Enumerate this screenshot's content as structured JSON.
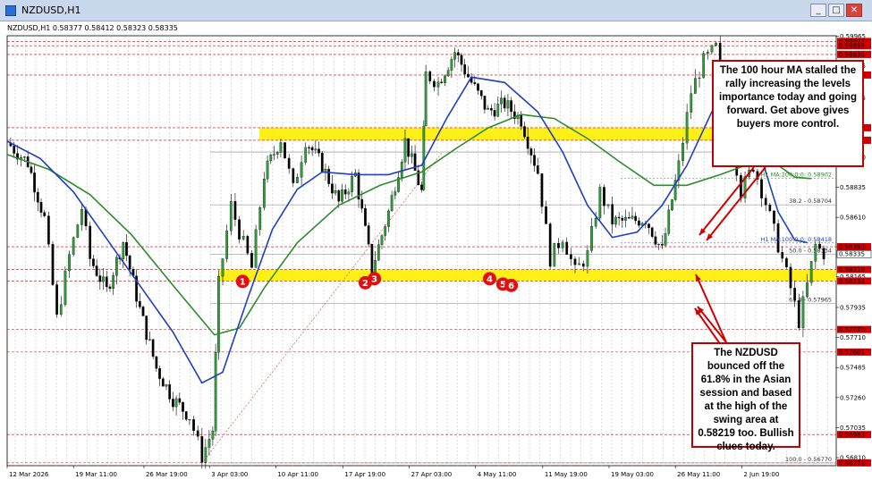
{
  "window": {
    "title": "NZDUSD,H1",
    "min_label": "_",
    "max_label": "□",
    "close_label": "✕"
  },
  "chart_info": "NZDUSD,H1  0.58377 0.58412 0.58323 0.58335",
  "chart_data": {
    "type": "candlestick",
    "symbol": "NZDUSD",
    "timeframe": "H1",
    "ohlc_header": {
      "open": 0.58377,
      "high": 0.58412,
      "low": 0.58323,
      "close": 0.58335
    },
    "x_tick_labels": [
      "12 Mar 2026",
      "19 Mar 11:00",
      "26 Mar 19:00",
      "3 Apr 03:00",
      "10 Apr 11:00",
      "17 Apr 19:00",
      "27 Apr 03:00",
      "4 May 11:00",
      "11 May 19:00",
      "19 May 03:00",
      "26 May 11:00",
      "2 Jun 19:00"
    ],
    "y_tick_labels": [
      "0.59965",
      "0.59745",
      "0.59505",
      "0.59280",
      "0.59060",
      "0.58835",
      "0.58610",
      "0.58390",
      "0.58165",
      "0.57935",
      "0.57710",
      "0.57485",
      "0.57260",
      "0.57035",
      "0.56810"
    ],
    "ylim": [
      0.5675,
      0.5997
    ],
    "price_path": [
      [
        0.0,
        0.5917
      ],
      [
        0.025,
        0.5902
      ],
      [
        0.045,
        0.586
      ],
      [
        0.06,
        0.5785
      ],
      [
        0.075,
        0.5832
      ],
      [
        0.09,
        0.5868
      ],
      [
        0.1,
        0.583
      ],
      [
        0.12,
        0.5806
      ],
      [
        0.14,
        0.5843
      ],
      [
        0.16,
        0.5792
      ],
      [
        0.18,
        0.5748
      ],
      [
        0.2,
        0.5725
      ],
      [
        0.22,
        0.5712
      ],
      [
        0.235,
        0.5682
      ],
      [
        0.248,
        0.5702
      ],
      [
        0.255,
        0.5811
      ],
      [
        0.27,
        0.587
      ],
      [
        0.28,
        0.585
      ],
      [
        0.295,
        0.5823
      ],
      [
        0.31,
        0.5893
      ],
      [
        0.33,
        0.592
      ],
      [
        0.345,
        0.5882
      ],
      [
        0.36,
        0.5919
      ],
      [
        0.38,
        0.59
      ],
      [
        0.4,
        0.5872
      ],
      [
        0.42,
        0.5893
      ],
      [
        0.44,
        0.5822
      ],
      [
        0.46,
        0.5865
      ],
      [
        0.48,
        0.5918
      ],
      [
        0.5,
        0.588
      ],
      [
        0.505,
        0.5968
      ],
      [
        0.52,
        0.5962
      ],
      [
        0.54,
        0.5985
      ],
      [
        0.56,
        0.5962
      ],
      [
        0.58,
        0.594
      ],
      [
        0.6,
        0.5946
      ],
      [
        0.62,
        0.5934
      ],
      [
        0.64,
        0.5895
      ],
      [
        0.655,
        0.583
      ],
      [
        0.67,
        0.5847
      ],
      [
        0.685,
        0.582
      ],
      [
        0.7,
        0.5833
      ],
      [
        0.715,
        0.588
      ],
      [
        0.73,
        0.5858
      ],
      [
        0.75,
        0.5858
      ],
      [
        0.77,
        0.586
      ],
      [
        0.79,
        0.5836
      ],
      [
        0.81,
        0.59
      ],
      [
        0.825,
        0.5955
      ],
      [
        0.84,
        0.5978
      ],
      [
        0.855,
        0.5988
      ],
      [
        0.87,
        0.5935
      ],
      [
        0.885,
        0.588
      ],
      [
        0.9,
        0.59
      ],
      [
        0.915,
        0.5872
      ],
      [
        0.93,
        0.584
      ],
      [
        0.945,
        0.5808
      ],
      [
        0.955,
        0.5783
      ],
      [
        0.965,
        0.581
      ],
      [
        0.975,
        0.584
      ],
      [
        0.985,
        0.5834
      ]
    ],
    "ma100_path": [
      [
        0.0,
        0.5918
      ],
      [
        0.04,
        0.5905
      ],
      [
        0.08,
        0.588
      ],
      [
        0.12,
        0.5845
      ],
      [
        0.16,
        0.581
      ],
      [
        0.2,
        0.5775
      ],
      [
        0.235,
        0.5737
      ],
      [
        0.26,
        0.5745
      ],
      [
        0.29,
        0.58
      ],
      [
        0.32,
        0.5852
      ],
      [
        0.35,
        0.5882
      ],
      [
        0.38,
        0.5895
      ],
      [
        0.42,
        0.5893
      ],
      [
        0.46,
        0.5893
      ],
      [
        0.5,
        0.59
      ],
      [
        0.53,
        0.5935
      ],
      [
        0.56,
        0.5966
      ],
      [
        0.6,
        0.5962
      ],
      [
        0.64,
        0.594
      ],
      [
        0.67,
        0.591
      ],
      [
        0.7,
        0.587
      ],
      [
        0.73,
        0.5846
      ],
      [
        0.76,
        0.585
      ],
      [
        0.79,
        0.587
      ],
      [
        0.82,
        0.59
      ],
      [
        0.85,
        0.594
      ],
      [
        0.87,
        0.5958
      ],
      [
        0.89,
        0.595
      ],
      [
        0.91,
        0.5905
      ],
      [
        0.93,
        0.5865
      ],
      [
        0.95,
        0.5844
      ],
      [
        0.965,
        0.5842
      ]
    ],
    "ma200_path": [
      [
        0.0,
        0.5908
      ],
      [
        0.05,
        0.5897
      ],
      [
        0.1,
        0.5878
      ],
      [
        0.15,
        0.5848
      ],
      [
        0.2,
        0.581
      ],
      [
        0.25,
        0.5773
      ],
      [
        0.28,
        0.5778
      ],
      [
        0.31,
        0.5808
      ],
      [
        0.35,
        0.5842
      ],
      [
        0.4,
        0.587
      ],
      [
        0.45,
        0.5885
      ],
      [
        0.5,
        0.5895
      ],
      [
        0.54,
        0.5912
      ],
      [
        0.58,
        0.5928
      ],
      [
        0.62,
        0.5938
      ],
      [
        0.66,
        0.5935
      ],
      [
        0.7,
        0.592
      ],
      [
        0.74,
        0.5902
      ],
      [
        0.78,
        0.5885
      ],
      [
        0.82,
        0.5885
      ],
      [
        0.86,
        0.5893
      ],
      [
        0.9,
        0.5902
      ],
      [
        0.93,
        0.59
      ],
      [
        0.95,
        0.5891
      ],
      [
        0.97,
        0.589
      ]
    ],
    "fib_levels": [
      {
        "label": "0.0 - 0.59099",
        "value": 0.59099
      },
      {
        "label": "38.2 - 0.58704",
        "value": 0.58704
      },
      {
        "label": "50.0 - 0.58334",
        "value": 0.58334
      },
      {
        "label": "61.8 - 0.57965",
        "value": 0.57965
      },
      {
        "label": "100.0 - 0.56770",
        "value": 0.5677
      }
    ],
    "ma_labels": [
      {
        "label": "H1 MA:200:0:0: 0.58902",
        "value": 0.58902,
        "color": "#2e8b2e"
      },
      {
        "label": "H1 MA:100:0:0: 0.58418",
        "value": 0.58418,
        "color": "#1f3fbf"
      }
    ],
    "levels": [
      {
        "label": "0.59927",
        "value": 0.59927,
        "color": "#d00000"
      },
      {
        "label": "0.59895",
        "value": 0.59895,
        "color": "#d00000"
      },
      {
        "label": "0.59830",
        "value": 0.5983,
        "color": "#d00000"
      },
      {
        "label": "0.59676",
        "value": 0.59676,
        "color": "#d00000"
      },
      {
        "label": "0.59281",
        "value": 0.59281,
        "color": "#d00000"
      },
      {
        "label": "0.59187",
        "value": 0.59187,
        "color": "#d00000"
      },
      {
        "label": "0.58390",
        "value": 0.5839,
        "color": "#d00000"
      },
      {
        "label": "0.58219",
        "value": 0.58219,
        "color": "#d00000"
      },
      {
        "label": "0.58133",
        "value": 0.58133,
        "color": "#d00000"
      },
      {
        "label": "0.57770",
        "value": 0.5777,
        "color": "#d00000"
      },
      {
        "label": "0.57601",
        "value": 0.57601,
        "color": "#d00000"
      },
      {
        "label": "0.56983",
        "value": 0.56983,
        "color": "#d00000"
      },
      {
        "label": "0.56771",
        "value": 0.56771,
        "color": "#d00000"
      }
    ],
    "current_price": {
      "label": "0.58335",
      "value": 0.58335
    },
    "zones": [
      {
        "from": 0.59187,
        "to": 0.59281,
        "color": "#ffee00"
      },
      {
        "from": 0.58133,
        "to": 0.58219,
        "color": "#ffee00"
      }
    ],
    "markers": [
      {
        "label": "1",
        "x": 0.284,
        "y": 0.5813
      },
      {
        "label": "2",
        "x": 0.432,
        "y": 0.5812
      },
      {
        "label": "3",
        "x": 0.443,
        "y": 0.5815
      },
      {
        "label": "4",
        "x": 0.582,
        "y": 0.5815
      },
      {
        "label": "5",
        "x": 0.598,
        "y": 0.5811
      },
      {
        "label": "6",
        "x": 0.608,
        "y": 0.581
      }
    ]
  },
  "callouts": {
    "top": "The 100 hour MA stalled the rally increasing the levels importance today and going forward. Get above gives buyers more control.",
    "bottom": "The NZDUSD bounced off the 61.8% in the Asian session and based at the high of the swing area at 0.58219 too. Bullish clues today."
  }
}
